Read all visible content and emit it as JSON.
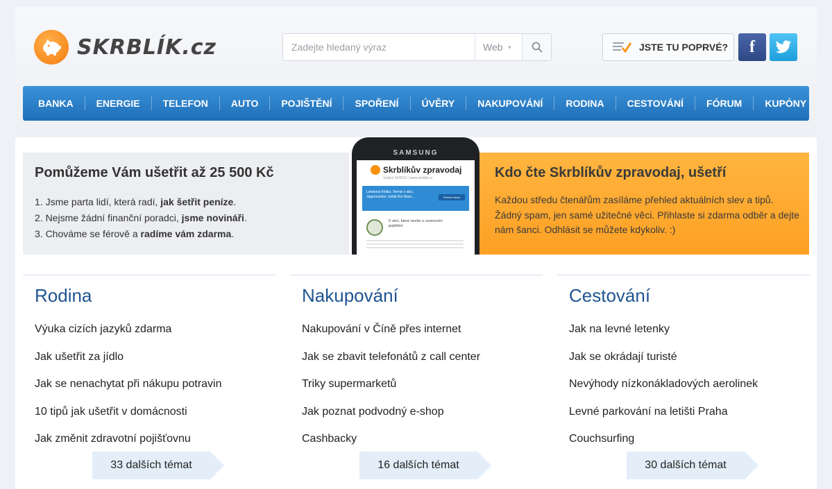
{
  "header": {
    "logo_text": "SKRBLÍK.cz",
    "search": {
      "placeholder": "Zadejte hledaný výraz",
      "scope": "Web"
    },
    "first_visit_label": "JSTE TU POPRVÉ?",
    "facebook_label": "f"
  },
  "nav": {
    "items": [
      {
        "label": "BANKA"
      },
      {
        "label": "ENERGIE"
      },
      {
        "label": "TELEFON"
      },
      {
        "label": "AUTO"
      },
      {
        "label": "POJIŠTĚNÍ"
      },
      {
        "label": "SPOŘENÍ"
      },
      {
        "label": "ÚVĚRY"
      },
      {
        "label": "NAKUPOVÁNÍ"
      },
      {
        "label": "RODINA"
      },
      {
        "label": "CESTOVÁNÍ"
      },
      {
        "label": "FÓRUM"
      },
      {
        "label": "KUPÓNY"
      }
    ]
  },
  "promo_left": {
    "title": "Pomůžeme Vám ušetřit až 25 500 Kč",
    "points": [
      {
        "pre": "1. Jsme parta lidí, která radí, ",
        "bold": "jak šetřit peníze",
        "post": "."
      },
      {
        "pre": "2. Nejsme žádní finanční poradci, ",
        "bold": "jsme novináři",
        "post": "."
      },
      {
        "pre": "3. Chováme se férově a ",
        "bold": "radíme vám zdarma",
        "post": "."
      }
    ]
  },
  "phone": {
    "brand": "SAMSUNG",
    "app_title": "Skrblíkův zpravodaj",
    "app_sub": "Vydání 43/2016 | www.skrblik.cz",
    "banner_text": "Letáková hlídka: Termix v akci, Jägermeister, tuňák Rio Mare…",
    "banner_button": "Přečíst hlavní",
    "item_text": "5 věcí, které nevíte o cestovním pojištění"
  },
  "promo_right": {
    "title": "Kdo čte Skrblíkův zpravodaj, ušetří",
    "text": "Každou středu čtenářům zasíláme přehled aktuálních slev a tipů. Žádný spam, jen samé užitečné věci. Přihlaste si zdarma odběr a dejte nám šanci. Odhlásit se můžete kdykoliv. :)"
  },
  "columns": [
    {
      "title": "Rodina",
      "links": [
        "Výuka cizích jazyků zdarma",
        "Jak ušetřit za jídlo",
        "Jak se nenachytat při nákupu potravin",
        "10 tipů jak ušetřit v domácnosti",
        "Jak změnit zdravotní pojišťovnu"
      ],
      "more": "33 dalších témat"
    },
    {
      "title": "Nakupování",
      "links": [
        "Nakupování v Číně přes internet",
        "Jak se zbavit telefonátů z call center",
        "Triky supermarketů",
        "Jak poznat podvodný e-shop",
        "Cashbacky"
      ],
      "more": "16 dalších témat"
    },
    {
      "title": "Cestování",
      "links": [
        "Jak na levné letenky",
        "Jak se okrádají turisté",
        "Nevýhody nízkonákladových aerolinek",
        "Levné parkování na letišti Praha",
        "Couchsurfing"
      ],
      "more": "30 dalších témat"
    }
  ],
  "colors": {
    "nav": "#2a80c8",
    "accent_orange": "#fea024",
    "title_blue": "#1f5490"
  }
}
